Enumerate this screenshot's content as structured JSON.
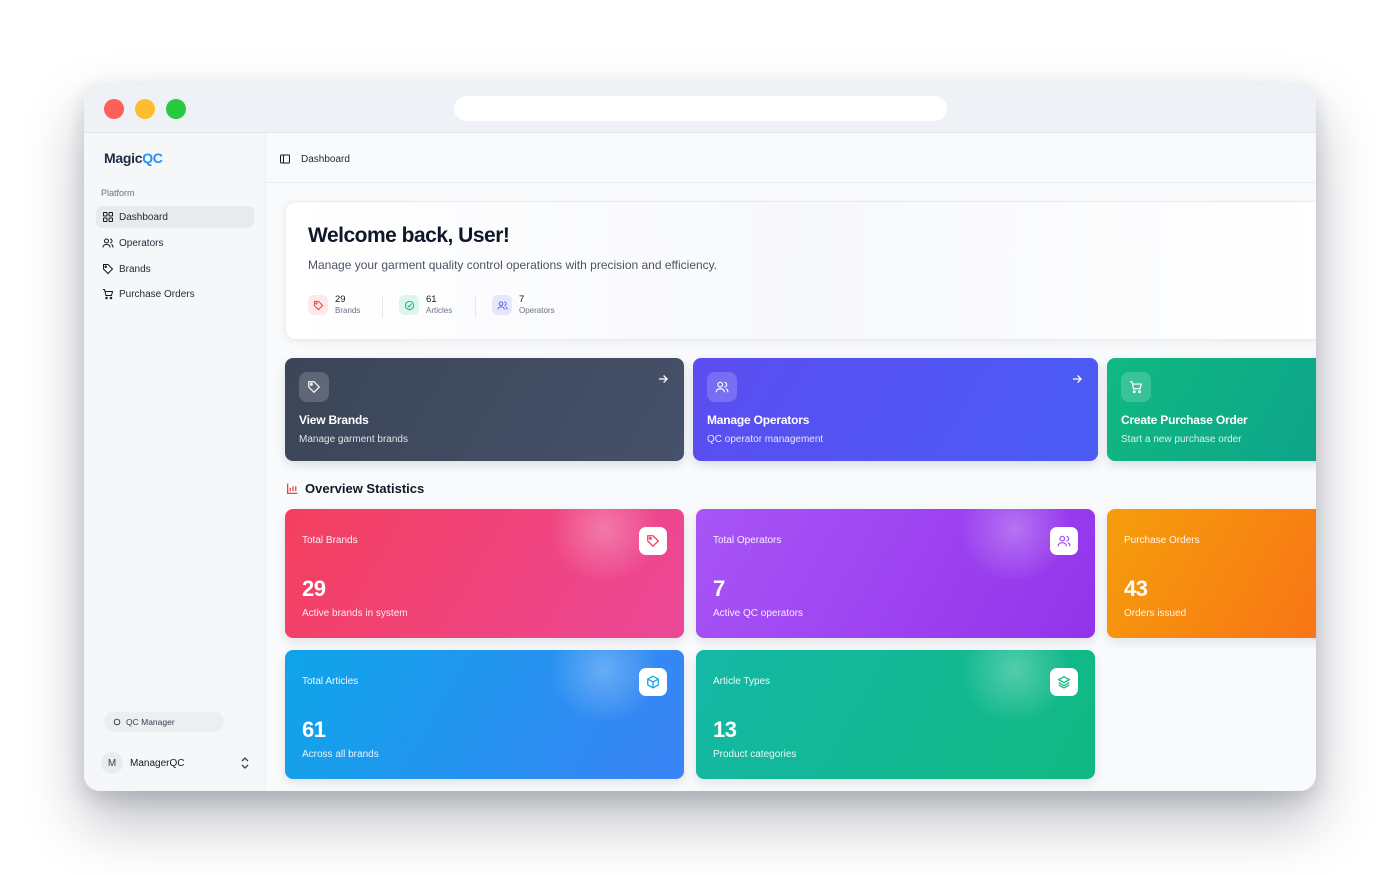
{
  "app": {
    "logo_part1": "Magic",
    "logo_part2": "QC"
  },
  "sidebar": {
    "section_label": "Platform",
    "items": [
      {
        "label": "Dashboard",
        "icon": "grid-icon",
        "active": true
      },
      {
        "label": "Operators",
        "icon": "users-icon",
        "active": false
      },
      {
        "label": "Brands",
        "icon": "tag-icon",
        "active": false
      },
      {
        "label": "Purchase Orders",
        "icon": "cart-icon",
        "active": false
      }
    ],
    "role_badge": "QC Manager",
    "user": {
      "initial": "M",
      "name": "ManagerQC"
    }
  },
  "topbar": {
    "breadcrumb": "Dashboard"
  },
  "welcome": {
    "title": "Welcome back, User!",
    "subtitle": "Manage your garment quality control operations with precision and efficiency.",
    "mini_stats": [
      {
        "value": "29",
        "label": "Brands",
        "icon": "tag-icon",
        "color": "#ef4444"
      },
      {
        "value": "61",
        "label": "Articles",
        "icon": "check-circle-icon",
        "color": "#10b981"
      },
      {
        "value": "7",
        "label": "Operators",
        "icon": "users-icon",
        "color": "#6366f1"
      }
    ]
  },
  "actions": [
    {
      "title": "View Brands",
      "desc": "Manage garment brands",
      "icon": "tag-icon"
    },
    {
      "title": "Manage Operators",
      "desc": "QC operator management",
      "icon": "users-icon"
    },
    {
      "title": "Create Purchase Order",
      "desc": "Start a new purchase order",
      "icon": "cart-icon"
    }
  ],
  "overview": {
    "heading": "Overview Statistics",
    "cards": [
      {
        "label": "Total Brands",
        "value": "29",
        "sub": "Active brands in system",
        "icon": "tag-icon",
        "color": "#f43f5e"
      },
      {
        "label": "Total Operators",
        "value": "7",
        "sub": "Active QC operators",
        "icon": "users-icon",
        "color": "#a855f7"
      },
      {
        "label": "Purchase Orders",
        "value": "43",
        "sub": "Orders issued",
        "icon": "cart-icon",
        "color": "#f59e0b"
      },
      {
        "label": "Total Articles",
        "value": "61",
        "sub": "Across all brands",
        "icon": "box-icon",
        "color": "#0ea5e9"
      },
      {
        "label": "Article Types",
        "value": "13",
        "sub": "Product categories",
        "icon": "layers-icon",
        "color": "#10b981"
      }
    ]
  },
  "colors": {
    "accent_blue": "#2b8ef0",
    "slate_card": "#3b4557",
    "indigo_card": "#5b4df0",
    "green_card": "#10b981"
  }
}
